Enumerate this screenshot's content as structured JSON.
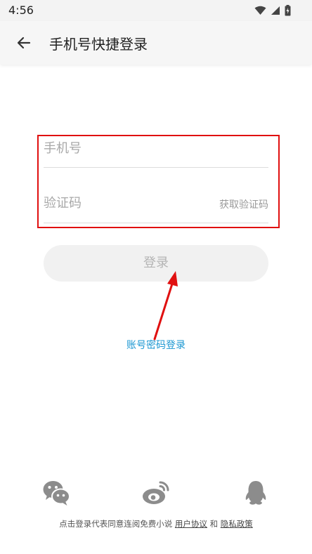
{
  "status_bar": {
    "time": "4:56"
  },
  "header": {
    "title": "手机号快捷登录"
  },
  "form": {
    "phone_placeholder": "手机号",
    "code_placeholder": "验证码",
    "get_code_label": "获取验证码"
  },
  "login_button": {
    "label": "登录"
  },
  "account_login_link": "账号密码登录",
  "social_logins": [
    "wechat",
    "weibo",
    "qq"
  ],
  "agreement": {
    "prefix": "点击登录代表同意连阅免费小说",
    "user_agreement": "用户协议",
    "and": "和",
    "privacy_policy": "隐私政策"
  },
  "colors": {
    "highlight_border": "#e01010",
    "link": "#1b97d2",
    "annotation_arrow": "#e01010",
    "icon_gray": "#8c8c8c"
  }
}
